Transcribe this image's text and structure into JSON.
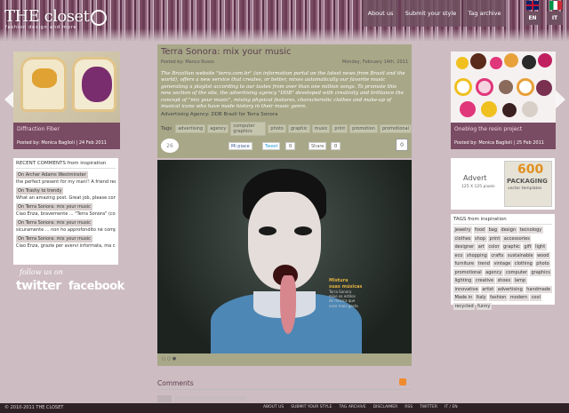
{
  "site": {
    "logo": "THE closet",
    "tagline": "fashion design and more"
  },
  "nav": {
    "about": "About us",
    "submit": "Submit your style",
    "tag_archive": "Tag archive",
    "lang_en": "EN",
    "lang_it": "IT"
  },
  "left": {
    "featured": {
      "title": "Diffraction Fiber",
      "meta": "Posted by: Monica Baglioli | 24 Feb 2011"
    },
    "recent": {
      "title": "RECENT COMMENTS from inspiration",
      "items": [
        {
          "tag": "On Archer Adams Westminster",
          "text": "the perfect present for my man!! A friend recommen ..."
        },
        {
          "tag": "On Trashy to trendy",
          "text": "What an amazing post. Great job, please continue ..."
        },
        {
          "tag": "On Terra Sonora: mix your music",
          "text": "Ciao Enza, bravemente ... \"Terra Sonora\" (comung ..."
        },
        {
          "tag": "On Terra Sonora: mix your music",
          "text": "sicuramente ... non ho approfondito né comprese ..."
        },
        {
          "tag": "On Terra Sonora: mix your music",
          "text": "Ciao Enza, grazie per avervi informata, ma credo ..."
        }
      ]
    },
    "follow": "follow us on",
    "twitter": "twitter",
    "facebook": "facebook"
  },
  "right": {
    "featured": {
      "title": "Oneblog the resin project",
      "meta": "Posted by: Monica Baglioli | 25 Feb 2011"
    },
    "advert": {
      "label": "Advert",
      "size": "125 X 125 pixels",
      "vector_num": "600",
      "vector_line1": "PACKAGING",
      "vector_line2": "vector templates"
    },
    "tags": {
      "title": "TAGS from inspiration",
      "items": [
        "jewelry",
        "food",
        "bag",
        "design",
        "tecnology",
        "clothes",
        "shop",
        "print",
        "accessories",
        "designer",
        "art",
        "color",
        "graphic",
        "gift",
        "light",
        "eco",
        "shopping",
        "crafts",
        "sustainable",
        "wood",
        "furniture",
        "trend",
        "vintage",
        "clothing",
        "photo",
        "promotional",
        "agency",
        "computer",
        "graphics",
        "lighting",
        "creative",
        "shoes",
        "lamp",
        "innovative",
        "artist",
        "advertising",
        "handmade",
        "Made in",
        "Italy",
        "fashion",
        "modern",
        "cool",
        "recycled",
        "funny"
      ]
    }
  },
  "post": {
    "title": "Terra Sonora: mix your music",
    "posted_by": "Posted by: Manco Russo",
    "date": "Monday, February 14th, 2011",
    "intro": "The Brazilian website \"terra.com.br\" (an information portal on the latest news from Brazil and the world), offers a new service that creates, or better, mixes automatically our favorite music generating a playlist according to our tastes from over than one million songs. To promote this new section of the site, the advertising agency \"DDB\" developed with creativity and brilliance the concept of \"mix your music\", mixing physical features, characteristic clothes and make-up of musical icons who have made history in their music genre.",
    "agency": "Advertising Agency: DDB Brazil for Terra Sonora",
    "tags_label": "Tags",
    "tags": [
      "advertising",
      "agency",
      "computer graphics",
      "photo",
      "graphic",
      "music",
      "print",
      "promotion",
      "promotional"
    ],
    "comments_count": "26",
    "share": {
      "fb_label": "Mi piace",
      "tweet_label": "Tweet",
      "tweet_count": "0",
      "share_label": "Share",
      "share_count": "0",
      "zero": "0"
    },
    "hero_caption": {
      "line1": "Mistura",
      "line2": "suas músicas",
      "line3": "Terra Sonora",
      "line4": "mixe os estilos",
      "line5": "de música que",
      "line6": "voce mais gosta"
    },
    "pager": "○ ○ ●",
    "comments_title": "Comments"
  },
  "footer": {
    "copyright": "© 2010-2011 THE CLOSET",
    "links": [
      "ABOUT US",
      "SUBMIT YOUR STYLE",
      "TAG ARCHIVE",
      "DISCLAIMER",
      "RSS",
      "TWITTER",
      "IT / EN"
    ]
  }
}
